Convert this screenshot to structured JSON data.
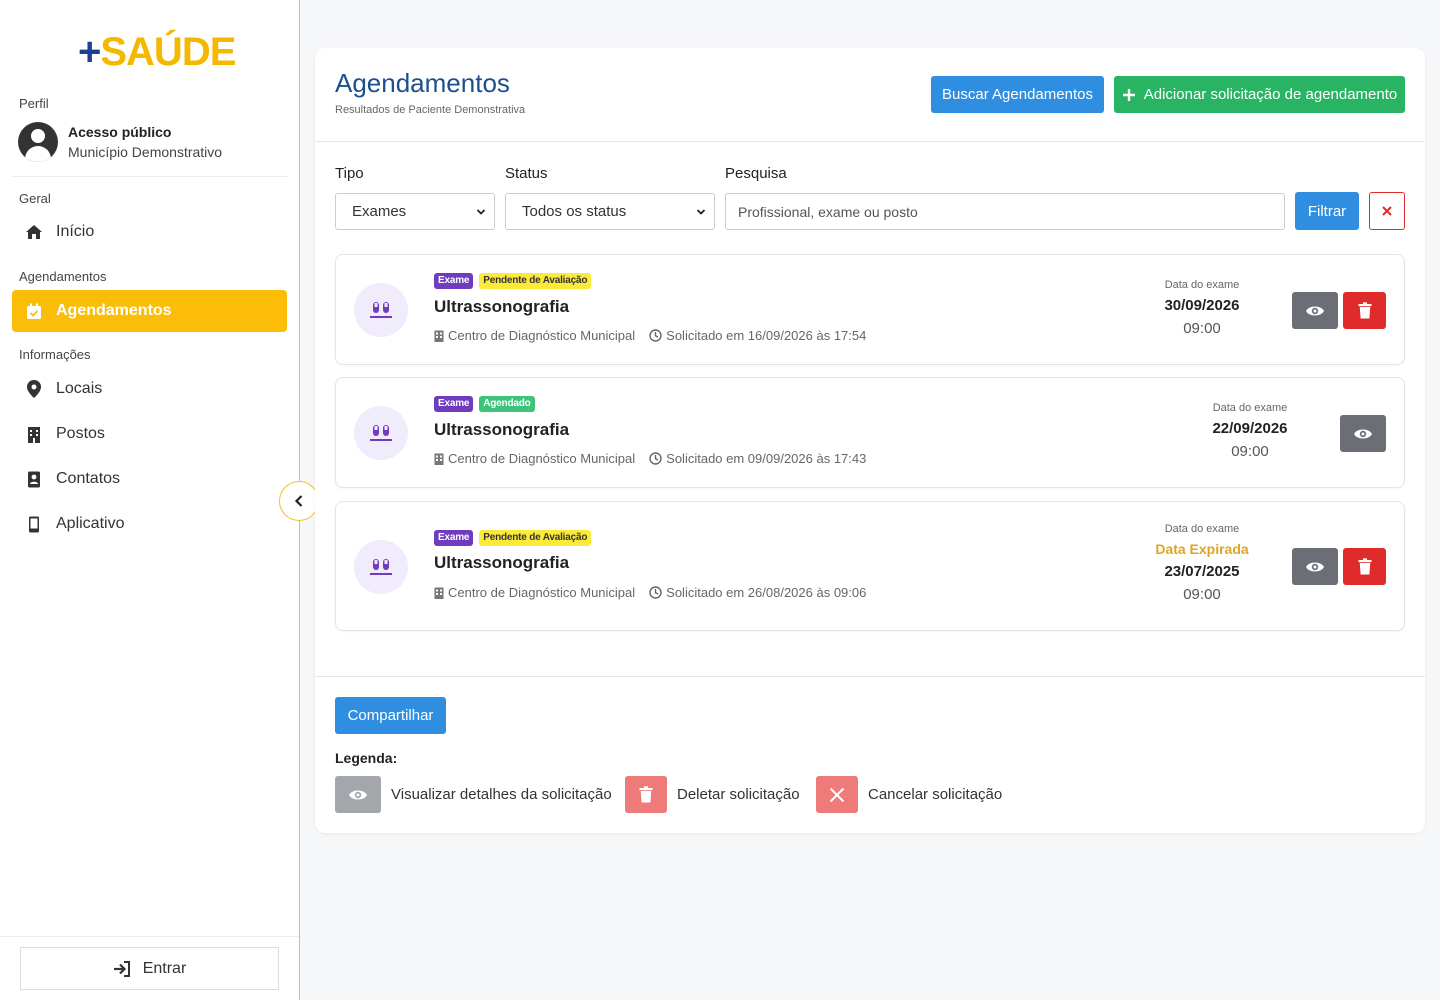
{
  "sidebar": {
    "logo_plus": "+",
    "logo_name": "SAÚDE",
    "profile_label": "Perfil",
    "profile_name": "Acesso público",
    "profile_org": "Município Demonstrativo",
    "sections": {
      "geral": "Geral",
      "agendamentos": "Agendamentos",
      "informacoes": "Informações"
    },
    "items": [
      {
        "label": "Início",
        "icon": "home-icon"
      },
      {
        "label": "Agendamentos",
        "icon": "calendar-check-icon",
        "active": true
      },
      {
        "label": "Locais",
        "icon": "map-pin-icon"
      },
      {
        "label": "Postos",
        "icon": "building-icon"
      },
      {
        "label": "Contatos",
        "icon": "contact-book-icon"
      },
      {
        "label": "Aplicativo",
        "icon": "mobile-icon"
      }
    ],
    "login_label": "Entrar"
  },
  "header": {
    "title": "Agendamentos",
    "subtitle": "Resultados de Paciente Demonstrativa",
    "search_button": "Buscar Agendamentos",
    "add_button": "Adicionar solicitação de agendamento"
  },
  "filters": {
    "tipo_label": "Tipo",
    "tipo_value": "Exames",
    "status_label": "Status",
    "status_value": "Todos os status",
    "search_label": "Pesquisa",
    "search_placeholder": "Profissional, exame ou posto",
    "filter_button": "Filtrar"
  },
  "results": [
    {
      "type_badge": "Exame",
      "status_badge": "Pendente de Avaliação",
      "status_kind": "pending",
      "title": "Ultrassonografia",
      "location": "Centro de Diagnóstico Municipal",
      "requested": "Solicitado em 16/09/2026 às 17:54",
      "date_label": "Data do exame",
      "expired_label": "",
      "date": "30/09/2026",
      "time": "09:00",
      "can_delete": true
    },
    {
      "type_badge": "Exame",
      "status_badge": "Agendado",
      "status_kind": "scheduled",
      "title": "Ultrassonografia",
      "location": "Centro de Diagnóstico Municipal",
      "requested": "Solicitado em 09/09/2026 às 17:43",
      "date_label": "Data do exame",
      "expired_label": "",
      "date": "22/09/2026",
      "time": "09:00",
      "can_delete": false
    },
    {
      "type_badge": "Exame",
      "status_badge": "Pendente de Avaliação",
      "status_kind": "pending",
      "title": "Ultrassonografia",
      "location": "Centro de Diagnóstico Municipal",
      "requested": "Solicitado em 26/08/2026 às 09:06",
      "date_label": "Data do exame",
      "expired_label": "Data Expirada",
      "date": "23/07/2025",
      "time": "09:00",
      "can_delete": true
    }
  ],
  "footer": {
    "share_button": "Compartilhar",
    "legend_title": "Legenda:",
    "legend": {
      "view": "Visualizar detalhes da solicitação",
      "delete": "Deletar solicitação",
      "cancel": "Cancelar solicitação"
    }
  },
  "colors": {
    "accent": "#fbbd08",
    "primary": "#2f8ee0",
    "success": "#28b463",
    "danger": "#e02b2b",
    "title": "#1d4f8f"
  }
}
